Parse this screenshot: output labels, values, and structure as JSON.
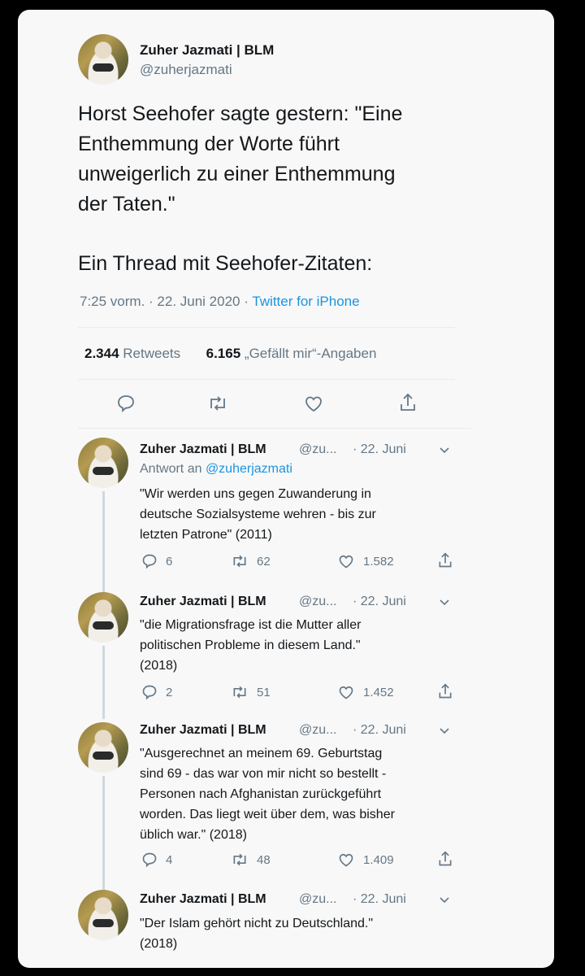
{
  "main_tweet": {
    "author_name": "Zuher Jazmati | BLM",
    "handle": "@zuherjazmati",
    "text_lines": [
      "Horst Seehofer sagte gestern: \"Eine",
      "Enthemmung der Worte führt",
      "unweigerlich zu einer Enthemmung",
      "der Taten.\""
    ],
    "text_line_5": "Ein Thread mit Seehofer-Zitaten:",
    "time": "7:25 vorm. · 22. Juni 2020 ·",
    "source": "Twitter for iPhone",
    "retweets_count": "2.344",
    "retweets_label": "Retweets",
    "likes_count": "6.165",
    "likes_label": "„Gefällt mir“-Angaben",
    "icons": [
      "reply-icon",
      "retweet-icon",
      "like-icon",
      "share-icon"
    ]
  },
  "replies": [
    {
      "author_name": "Zuher Jazmati | BLM",
      "handle_trunc": "@zu...",
      "date": "· 22. Juni",
      "reply_to_prefix": "Antwort an",
      "reply_to_handle": "@zuherjazmati",
      "text_lines": [
        "\"Wir werden uns gegen Zuwanderung in",
        "deutsche Sozialsysteme wehren - bis zur",
        "letzten Patrone\" (2011)"
      ],
      "replies": "6",
      "retweets": "62",
      "likes": "1.582"
    },
    {
      "author_name": "Zuher Jazmati | BLM",
      "handle_trunc": "@zu...",
      "date": "· 22. Juni",
      "text_lines": [
        "\"die Migrationsfrage ist die Mutter aller",
        "politischen Probleme in diesem Land.\"",
        "(2018)"
      ],
      "replies": "2",
      "retweets": "51",
      "likes": "1.452"
    },
    {
      "author_name": "Zuher Jazmati | BLM",
      "handle_trunc": "@zu...",
      "date": "· 22. Juni",
      "text_lines": [
        "\"Ausgerechnet an meinem 69. Geburtstag",
        "sind 69 - das war von mir nicht so bestellt -",
        "Personen nach Afghanistan zurückgeführt",
        "worden. Das liegt weit über dem, was bisher",
        "üblich war.\" (2018)"
      ],
      "replies": "4",
      "retweets": "48",
      "likes": "1.409"
    },
    {
      "author_name": "Zuher Jazmati | BLM",
      "handle_trunc": "@zu...",
      "date": "· 22. Juni",
      "text_lines": [
        "\"Der Islam gehört nicht zu Deutschland.\"",
        "(2018)"
      ]
    }
  ]
}
